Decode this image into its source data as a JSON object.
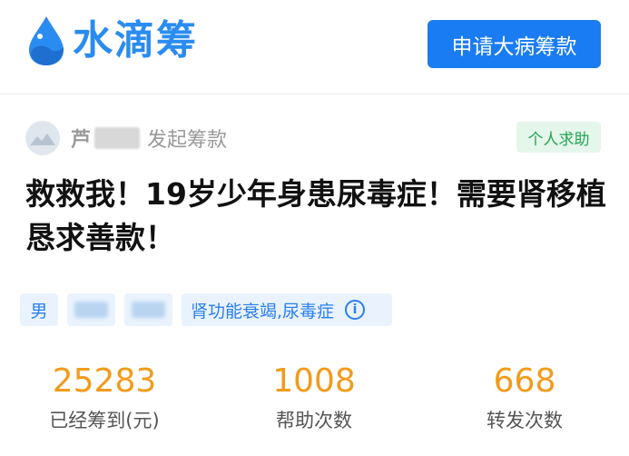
{
  "brand": {
    "name": "水滴筹",
    "color": "#2a8cf0"
  },
  "header": {
    "apply_button": "申请大病筹款"
  },
  "initiator": {
    "name": "芦",
    "action": "发起筹款"
  },
  "badge": {
    "label": "个人求助",
    "color": "#23a455"
  },
  "title": "救救我！19岁少年身患尿毒症！需要肾移植恳求善款！",
  "tags": {
    "gender": "男",
    "illness": "肾功能衰竭,尿毒症",
    "info_icon": "i"
  },
  "stats": [
    {
      "value": "25283",
      "label": "已经筹到(元)"
    },
    {
      "value": "1008",
      "label": "帮助次数"
    },
    {
      "value": "668",
      "label": "转发次数"
    }
  ],
  "colors": {
    "accent": "#1a7cf2",
    "stat_value": "#f29b1a"
  }
}
